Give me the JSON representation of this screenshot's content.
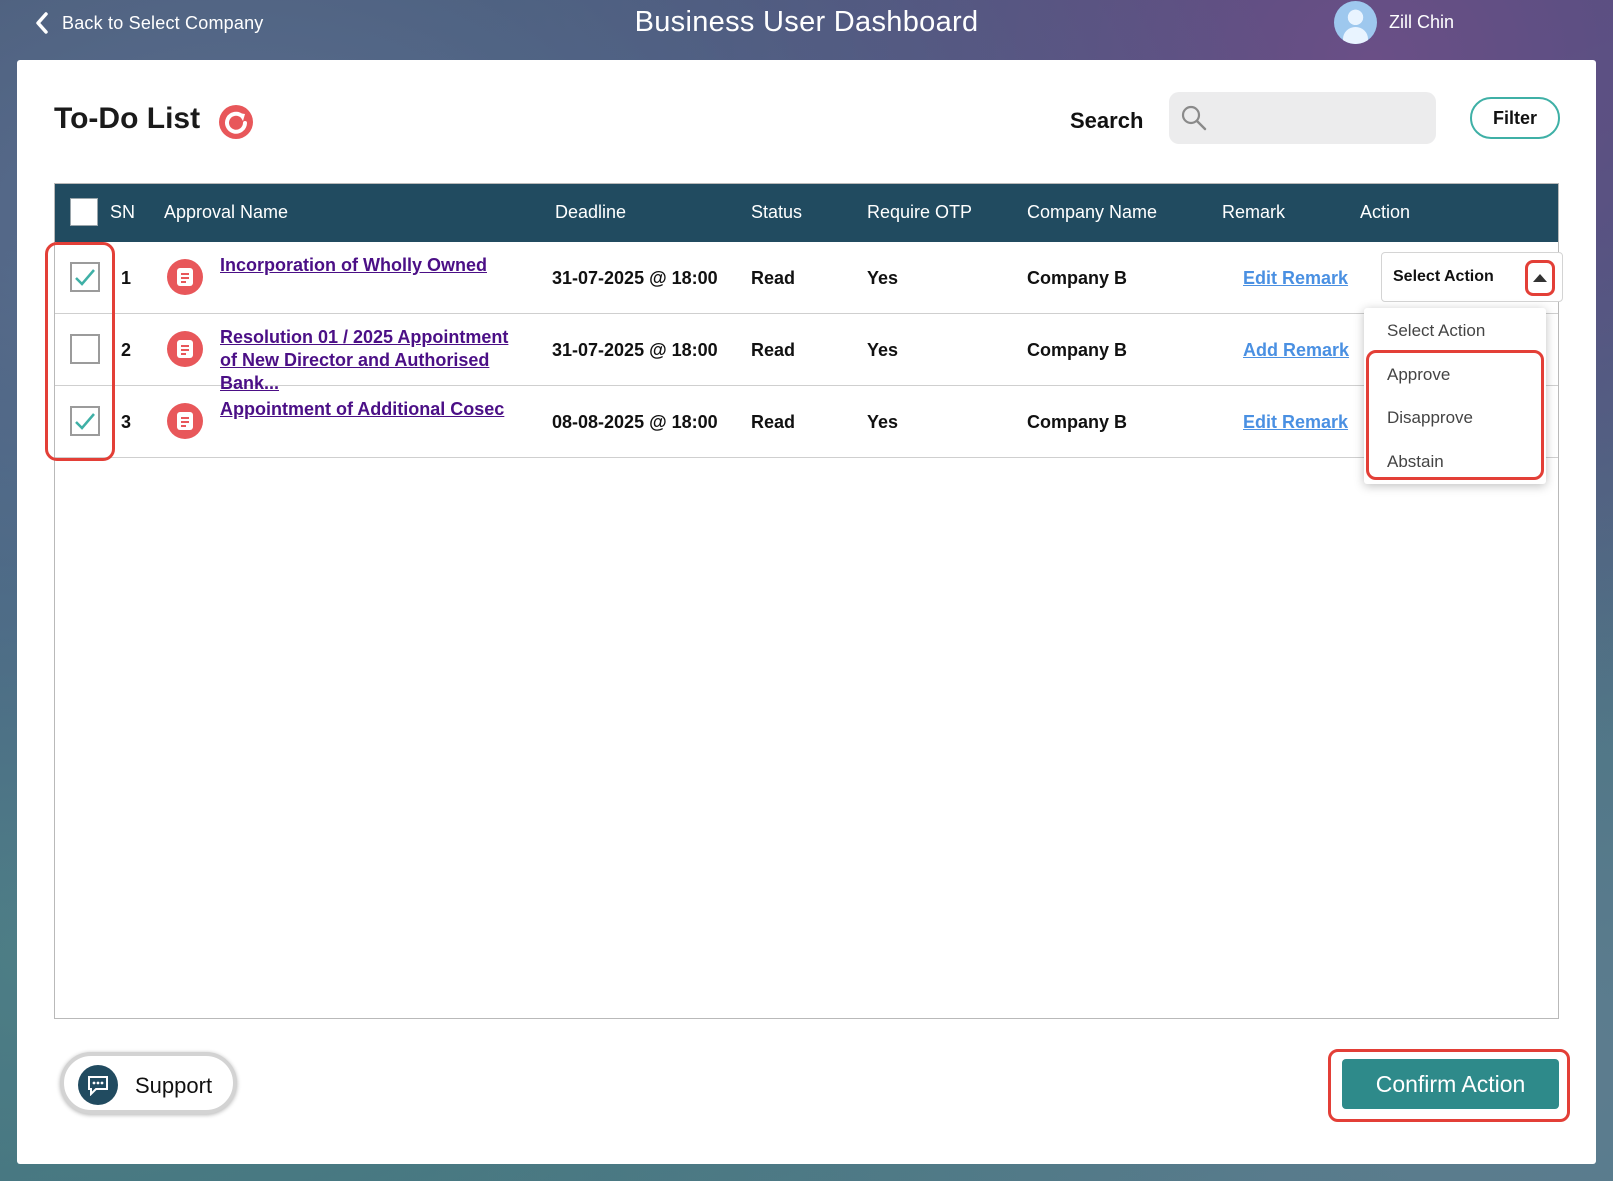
{
  "topbar": {
    "back_label": "Back to Select Company",
    "title": "Business User Dashboard",
    "user_name": "Zill Chin"
  },
  "card": {
    "title": "To-Do List",
    "search_label": "Search",
    "search_value": "",
    "filter_label": "Filter"
  },
  "table": {
    "headers": {
      "sn": "SN",
      "approval_name": "Approval Name",
      "deadline": "Deadline",
      "status": "Status",
      "require_otp": "Require OTP",
      "company_name": "Company Name",
      "remark": "Remark",
      "action": "Action"
    },
    "rows": [
      {
        "checked": true,
        "sn": "1",
        "approval_name": "Incorporation of Wholly Owned",
        "deadline": "31-07-2025 @ 18:00",
        "status": "Read",
        "require_otp": "Yes",
        "company_name": "Company B",
        "remark": "Edit Remark"
      },
      {
        "checked": false,
        "sn": "2",
        "approval_name": "Resolution 01 / 2025 Appointment of New Director and Authorised Bank...",
        "deadline": "31-07-2025 @ 18:00",
        "status": "Read",
        "require_otp": "Yes",
        "company_name": "Company B",
        "remark": "Add Remark"
      },
      {
        "checked": true,
        "sn": "3",
        "approval_name": "Appointment of Additional Cosec",
        "deadline": "08-08-2025 @ 18:00",
        "status": "Read",
        "require_otp": "Yes",
        "company_name": "Company B",
        "remark": "Edit Remark"
      }
    ],
    "action_select": {
      "selected": "Select Action",
      "options": [
        "Select Action",
        "Approve",
        "Disapprove",
        "Abstain"
      ]
    }
  },
  "footer": {
    "support_label": "Support",
    "confirm_label": "Confirm Action"
  },
  "colors": {
    "header_bg": "#214b60",
    "accent_red": "#e33f37",
    "confirm_bg": "#2e8a8a",
    "link_purple": "#4b0f86",
    "link_blue": "#4a90e2"
  }
}
